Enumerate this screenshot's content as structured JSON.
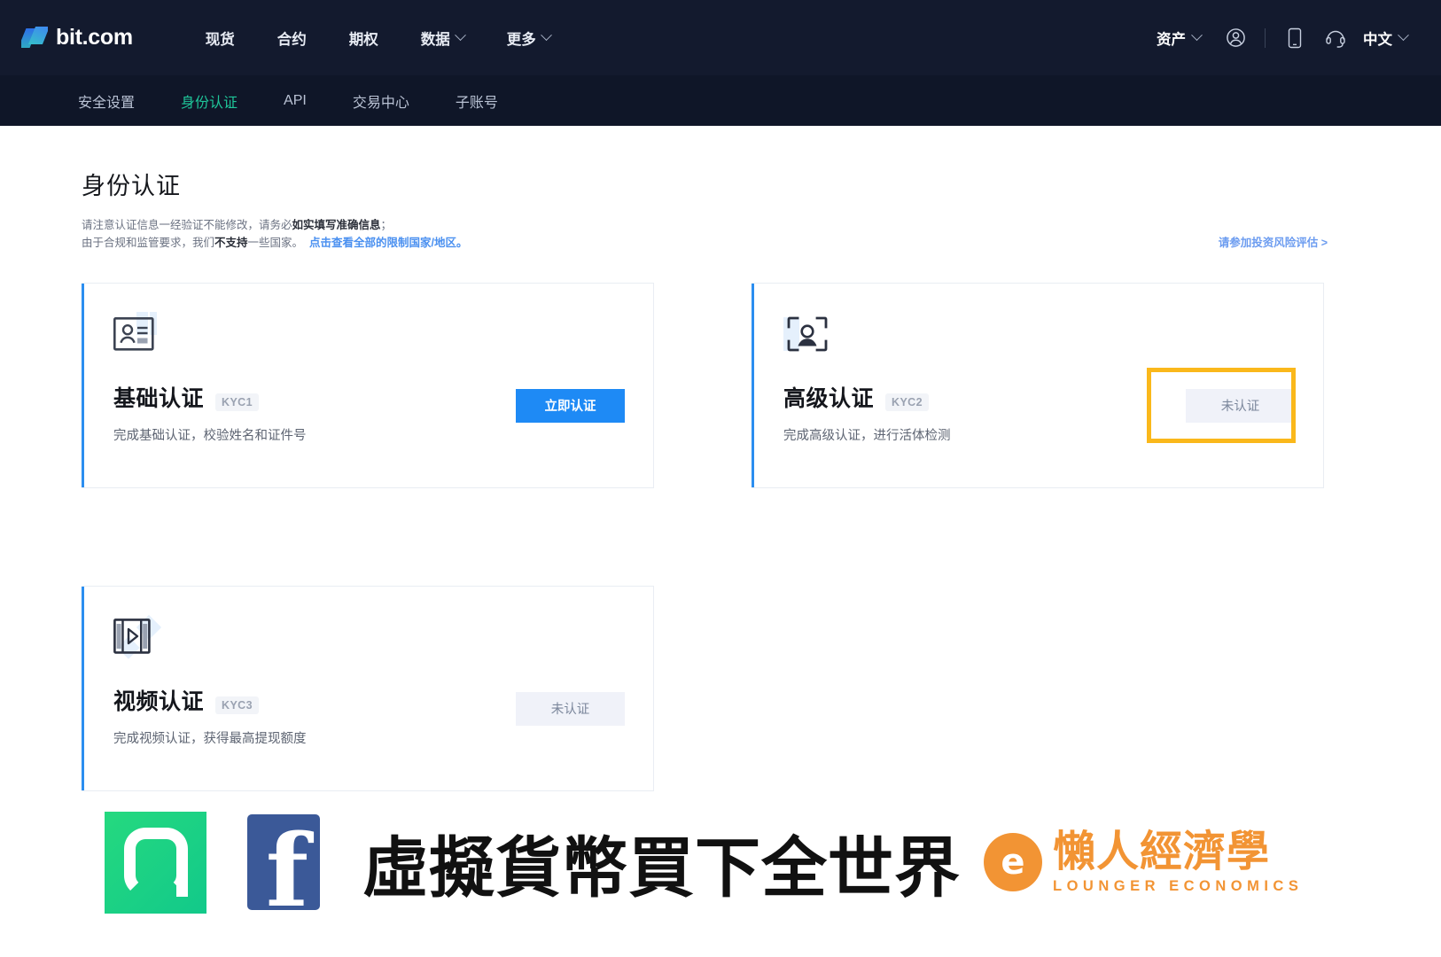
{
  "header": {
    "brand": "bit.com",
    "nav": [
      {
        "label": "现货",
        "has_caret": false
      },
      {
        "label": "合约",
        "has_caret": false
      },
      {
        "label": "期权",
        "has_caret": false
      },
      {
        "label": "数据",
        "has_caret": true
      },
      {
        "label": "更多",
        "has_caret": true
      }
    ],
    "assets_label": "资产",
    "language_label": "中文",
    "icons": [
      "user-icon",
      "mobile-app-icon",
      "support-headset-icon"
    ]
  },
  "subnav": {
    "tabs": [
      {
        "label": "安全设置",
        "active": false
      },
      {
        "label": "身份认证",
        "active": true
      },
      {
        "label": "API",
        "active": false
      },
      {
        "label": "交易中心",
        "active": false
      },
      {
        "label": "子账号",
        "active": false
      }
    ]
  },
  "main": {
    "title": "身份认证",
    "description_line1_pre": "请注意认证信息一经验证不能修改，请务必",
    "description_line1_bold": "如实填写准确信息",
    "description_line1_post": "；",
    "description_line2_pre": "由于合规和监管要求，我们",
    "description_line2_bold": "不支持",
    "description_line2_post": "一些国家。",
    "description_line2_link": "点击查看全部的限制国家/地区。",
    "risk_assessment_link": "请参加投资风险评估 >",
    "cards": [
      {
        "title": "基础认证",
        "badge": "KYC1",
        "subtitle": "完成基础认证，校验姓名和证件号",
        "action_label": "立即认证",
        "action_state": "primary",
        "icon": "id-card-icon",
        "highlighted": false
      },
      {
        "title": "高级认证",
        "badge": "KYC2",
        "subtitle": "完成高级认证，进行活体检测",
        "action_label": "未认证",
        "action_state": "disabled",
        "icon": "face-scan-icon",
        "highlighted": true
      },
      {
        "title": "视频认证",
        "badge": "KYC3",
        "subtitle": "完成视频认证，获得最高提现额度",
        "action_label": "未认证",
        "action_state": "disabled",
        "icon": "video-film-icon",
        "highlighted": false
      }
    ]
  },
  "watermark": {
    "headline": "虛擬貨幣買下全世界",
    "brand_mark_letter": "e",
    "brand_cn": "懶人經濟學",
    "brand_en": "LOUNGER ECONOMICS",
    "social_icons": [
      "line-icon",
      "facebook-icon"
    ]
  },
  "colors": {
    "header_bg": "#131a2e",
    "subnav_bg": "#0f1628",
    "active_tab": "#1fc79a",
    "primary_button": "#1e8af5",
    "card_accent": "#2b8ef0",
    "highlight_border": "#fab81b",
    "link": "#4a90f0",
    "brand_orange": "#f29434",
    "line_green": "#1ccf7f",
    "facebook_blue": "#3b5998"
  }
}
